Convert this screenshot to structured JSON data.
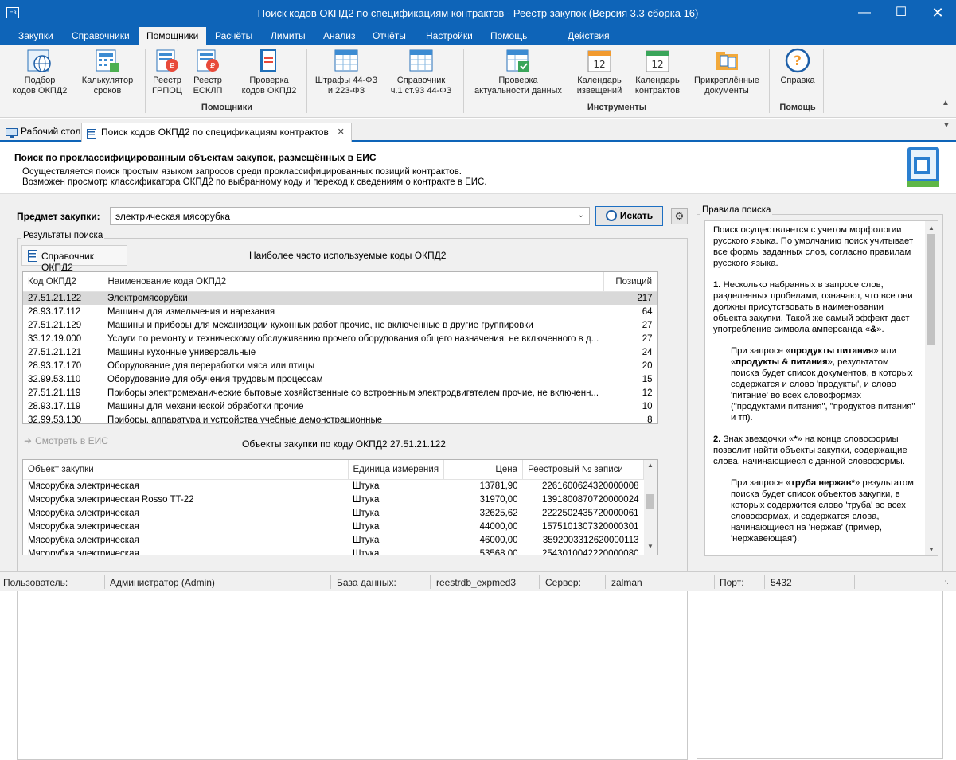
{
  "window": {
    "title": "Поиск кодов ОКПД2 по спецификациям контрактов - Реестр закупок (Версия 3.3 сборка 16)",
    "app_icon": "Ез"
  },
  "menu": [
    "Закупки",
    "Справочники",
    "Помощники",
    "Расчёты",
    "Лимиты",
    "Анализ",
    "Отчёты",
    "Настройки",
    "Помощь",
    "Действия"
  ],
  "ribbon": {
    "buttons": [
      {
        "label": "Подбор\nкодов ОКПД2",
        "icon": "globe-grid-icon"
      },
      {
        "label": "Калькулятор\nсроков",
        "icon": "calculator-icon"
      },
      {
        "label": "Реестр\nГРПОЦ",
        "icon": "registry-ruble-icon"
      },
      {
        "label": "Реестр\nЕСКЛП",
        "icon": "registry-ruble-icon"
      },
      {
        "label": "Проверка\nкодов ОКПД2",
        "icon": "book-check-icon"
      },
      {
        "label": "Штрафы 44-ФЗ\nи 223-ФЗ",
        "icon": "table-icon"
      },
      {
        "label": "Справочник\nч.1 ст.93 44-ФЗ",
        "icon": "table-icon"
      },
      {
        "label": "Проверка\nактуальности данных",
        "icon": "table-check-icon"
      },
      {
        "label": "Календарь\nизвещений",
        "icon": "calendar-orange-icon",
        "num": "12"
      },
      {
        "label": "Календарь\nконтрактов",
        "icon": "calendar-green-icon",
        "num": "12"
      },
      {
        "label": "Прикреплённые\nдокументы",
        "icon": "folder-documents-icon"
      },
      {
        "label": "Справка",
        "icon": "help-icon"
      }
    ],
    "groups": [
      "Помощники",
      "Инструменты",
      "Помощь"
    ]
  },
  "tabs": [
    {
      "label": "Рабочий стол"
    },
    {
      "label": "Поиск кодов ОКПД2 по спецификациям контрактов"
    }
  ],
  "header": {
    "title": "Поиск по проклассифицированным объектам закупок, размещённых в ЕИС",
    "line1": "Осуществляется поиск простым языком запросов среди проклассифицированных позиций контрактов.",
    "line2": "Возможен просмотр классификатора ОКПД2 по выбранному коду и переход к сведениям о контракте в ЕИС."
  },
  "search": {
    "label": "Предмет закупки:",
    "value": "электрическая  мясорубка",
    "button": "Искать"
  },
  "results": {
    "group_title": "Результаты поиска",
    "ref_button": "Справочник ОКПД2",
    "caption": "Наиболее часто используемые коды ОКПД2",
    "columns": [
      "Код ОКПД2",
      "Наименование кода ОКПД2",
      "Позиций"
    ],
    "rows": [
      [
        "27.51.21.122",
        "Электромясорубки",
        "217"
      ],
      [
        "28.93.17.112",
        "Машины для измельчения и нарезания",
        "64"
      ],
      [
        "27.51.21.129",
        "Машины и приборы для механизации кухонных работ прочие, не включенные в другие группировки",
        "27"
      ],
      [
        "33.12.19.000",
        "Услуги по ремонту и техническому обслуживанию прочего оборудования общего назначения, не включенного в д...",
        "27"
      ],
      [
        "27.51.21.121",
        "Машины кухонные универсальные",
        "24"
      ],
      [
        "28.93.17.170",
        "Оборудование для переработки мяса или птицы",
        "20"
      ],
      [
        "32.99.53.110",
        "Оборудование для обучения трудовым процессам",
        "15"
      ],
      [
        "27.51.21.119",
        "Приборы электромеханические бытовые хозяйственные со встроенным электродвигателем прочие, не включенн...",
        "12"
      ],
      [
        "28.93.17.119",
        "Машины для механической обработки прочие",
        "10"
      ],
      [
        "32.99.53.130",
        "Приборы, аппаратура и устройства учебные демонстрационные",
        "8"
      ]
    ]
  },
  "objects": {
    "view_button": "Смотреть в ЕИС",
    "caption": "Объекты закупки по коду ОКПД2 27.51.21.122",
    "columns": [
      "Объект закупки",
      "Единица измерения",
      "Цена",
      "Реестровый № записи"
    ],
    "rows": [
      [
        "Мясорубка электрическая",
        "Штука",
        "13781,90",
        "2261600624320000008"
      ],
      [
        "Мясорубка электрическая Rosso TT-22",
        "Штука",
        "31970,00",
        "1391800870720000024"
      ],
      [
        "Мясорубка электрическая",
        "Штука",
        "32625,62",
        "2222502435720000061"
      ],
      [
        "Мясорубка электрическая",
        "Штука",
        "44000,00",
        "1575101307320000301"
      ],
      [
        "Мясорубка электрическая",
        "Штука",
        "46000,00",
        "3592003312620000113"
      ],
      [
        "Мясорубка электрическая",
        "Штука",
        "53568,00",
        "2543010042220000080"
      ]
    ]
  },
  "rules": {
    "title": "Правила поиска",
    "p1": "Поиск осуществляется с учетом морфологии русского языка. По умолчанию поиск учитывает все формы заданных слов, согласно правилам русского языка.",
    "p2_num": "1.",
    "p2": "Несколько набранных в запросе слов, разделенных пробелами, означают, что все они должны присутствовать в наименовании объекта закупки. Такой же самый эффект даст употребление символа амперсанда «",
    "p2_amp": "&",
    "p2_end": "».",
    "p3_a": "При запросе «",
    "p3_b": "продукты питания",
    "p3_c": "» или «",
    "p3_d": "продукты & питания",
    "p3_e": "», результатом поиска будет список документов, в которых содержатся и слово 'продукты', и слово 'питание' во всех словоформах (\"продуктами питания\", \"продуктов питания\" и тп).",
    "p4_num": "2.",
    "p4_a": "Знак звездочки «",
    "p4_star": "*",
    "p4_b": "» на конце словоформы позволит найти объекты закупки, содержащие слова, начинающиеся с данной словоформы.",
    "p5_a": "При запросе «",
    "p5_b": "труба нержав*",
    "p5_c": "» результатом поиска будет список объектов закупки, в которых содержится слово 'труба' во всех словоформах, и содержатся слова, начинающиеся на 'нержав' (пример, 'нержавеющая')."
  },
  "status": {
    "user_label": "Пользователь:",
    "user": "Администратор (Admin)",
    "db_label": "База данных:",
    "db": "reestrdb_expmed3",
    "server_label": "Сервер:",
    "server": "zalman",
    "port_label": "Порт:",
    "port": "5432"
  }
}
